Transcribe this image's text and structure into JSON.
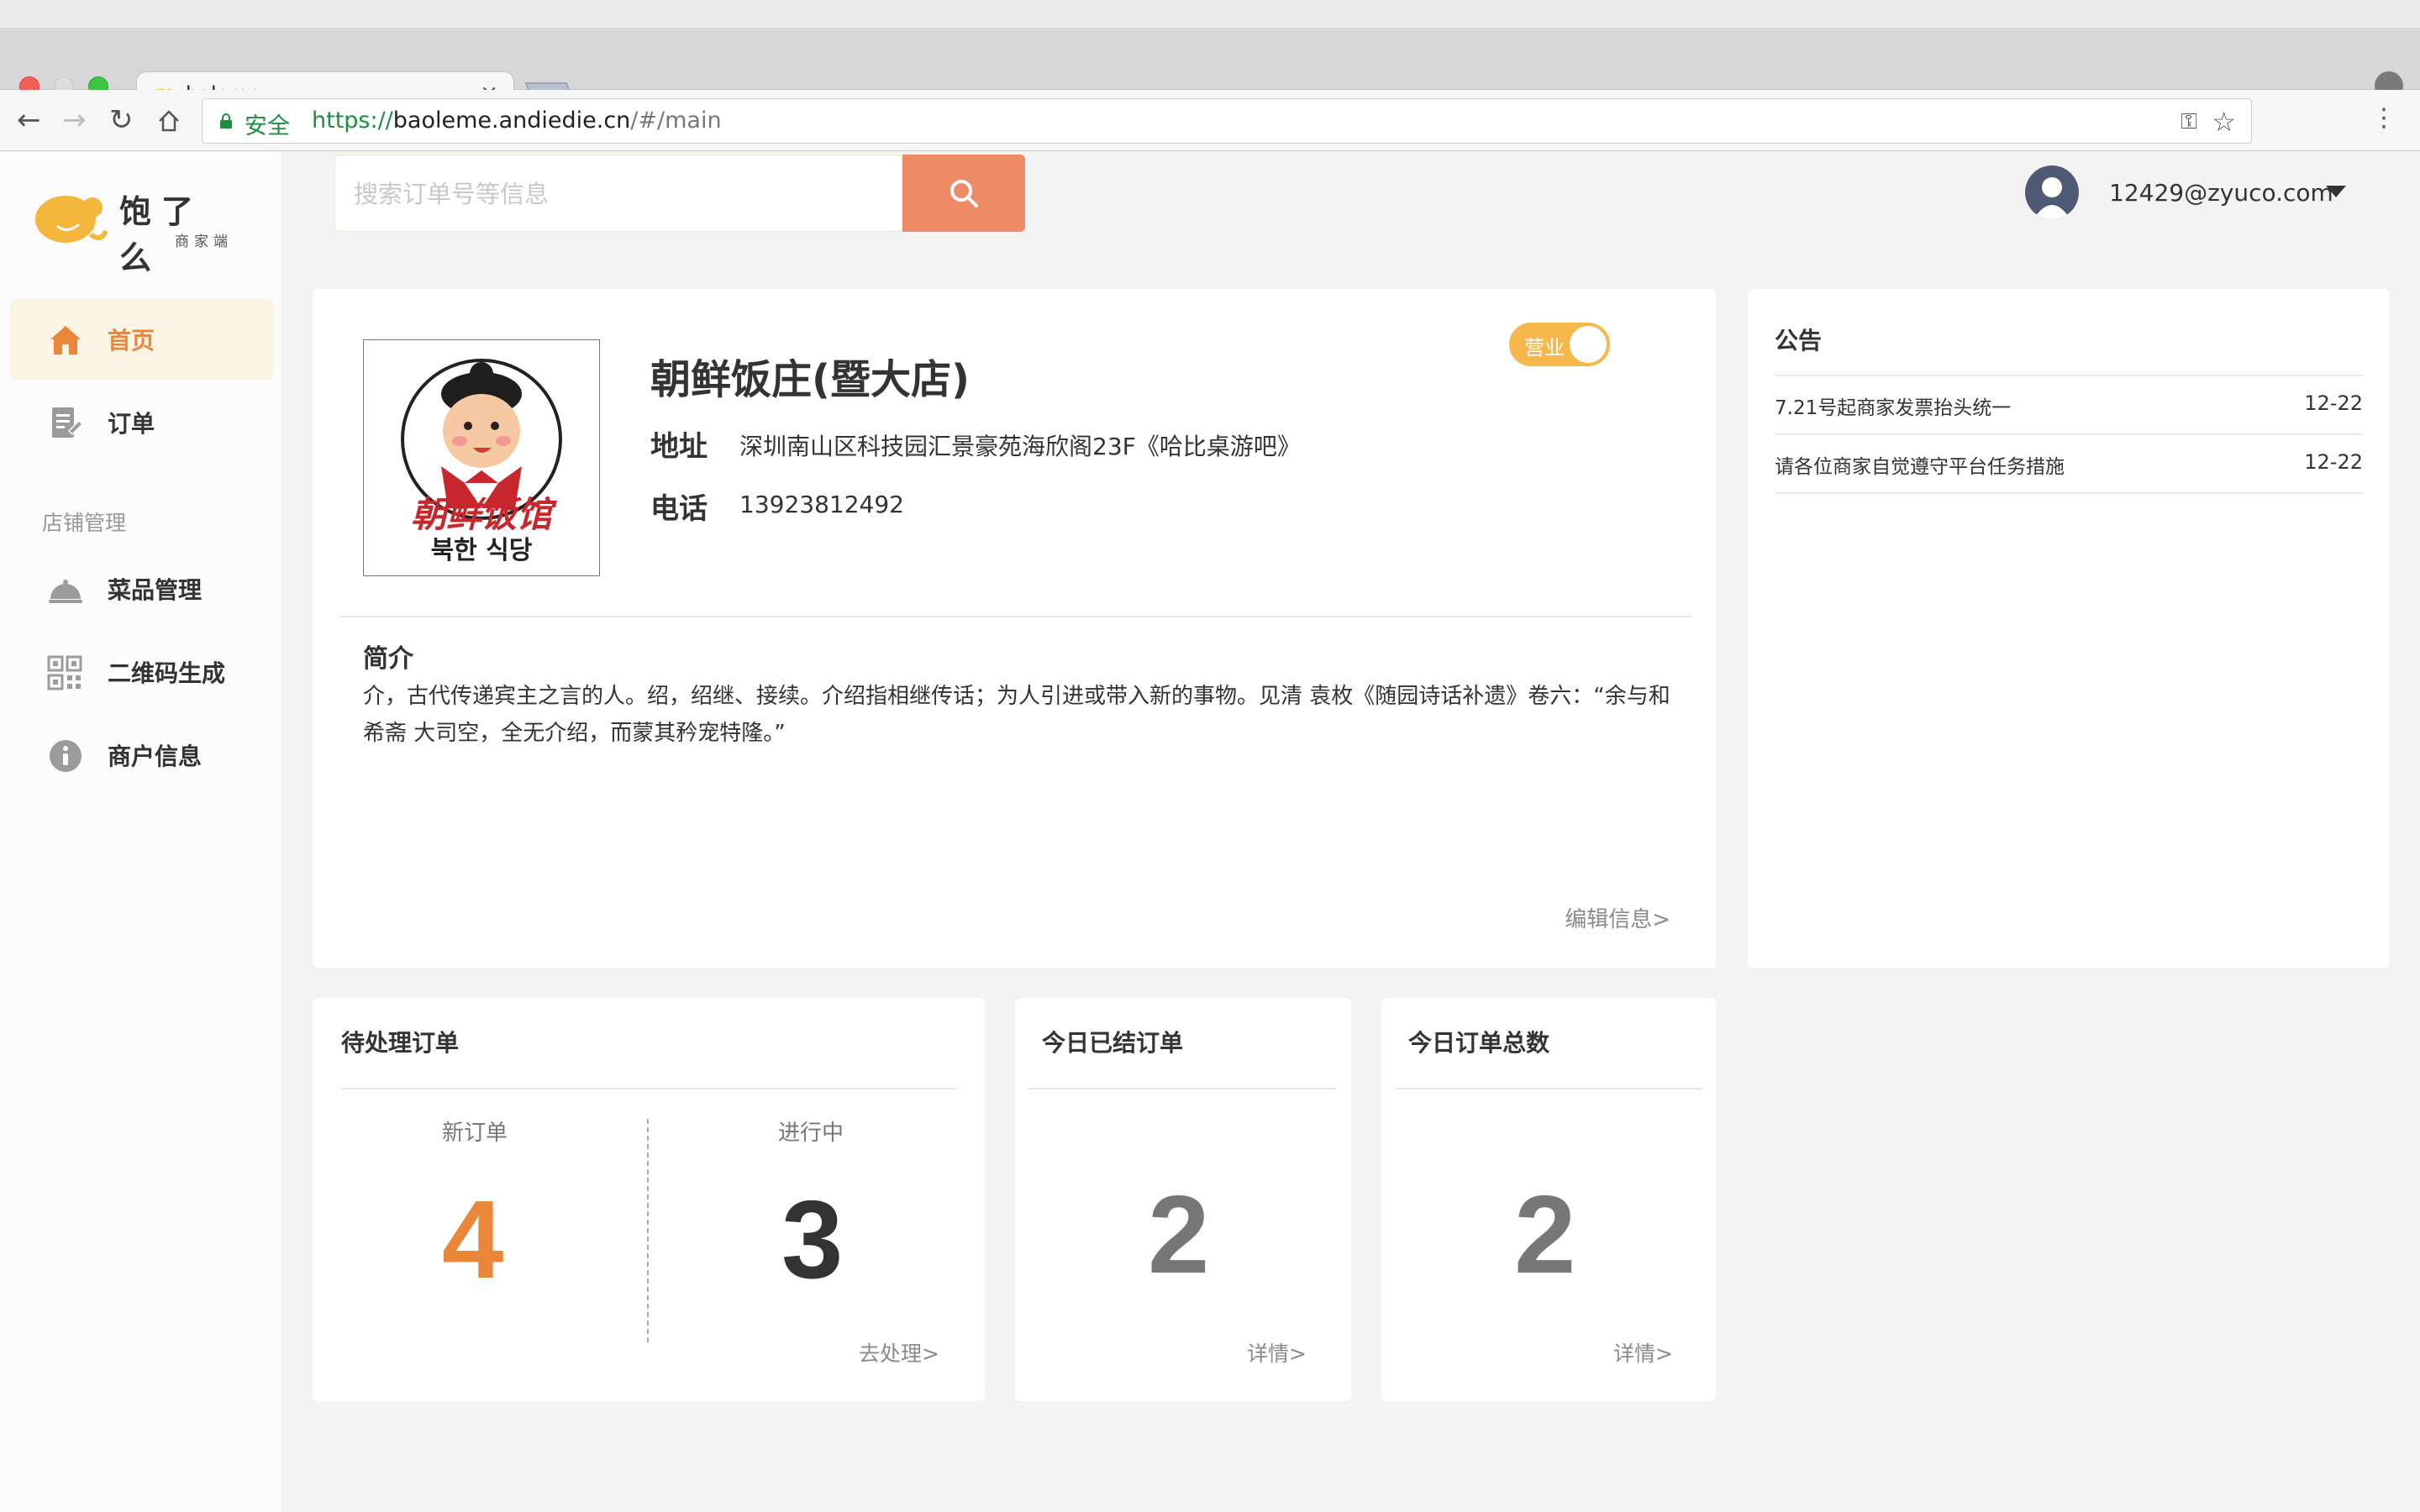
{
  "browser": {
    "tab_title": "baleme",
    "secure_label": "安全",
    "url_scheme": "https://",
    "url_host": "baoleme.andiedie.cn",
    "url_path": "/#/main"
  },
  "brand": {
    "name": "饱了么",
    "subtitle": "商家端",
    "accent": "#e8873a",
    "logo_color": "#f5b73b"
  },
  "search": {
    "placeholder": "搜索订单号等信息",
    "button_color": "#ed8b67"
  },
  "user": {
    "email": "12429@zyuco.com"
  },
  "sidebar": {
    "items": [
      {
        "label": "首页",
        "icon": "home-icon",
        "active": true
      },
      {
        "label": "订单",
        "icon": "order-icon",
        "active": false
      }
    ],
    "section_label": "店铺管理",
    "shop_items": [
      {
        "label": "菜品管理",
        "icon": "dish-icon"
      },
      {
        "label": "二维码生成",
        "icon": "qrcode-icon"
      },
      {
        "label": "商户信息",
        "icon": "info-icon"
      }
    ]
  },
  "shop": {
    "name": "朝鲜饭庄(暨大店)",
    "status_label": "营业",
    "status_on": true,
    "address_label": "地址",
    "address": "深圳南山区科技园汇景豪苑海欣阁23F《哈比桌游吧》",
    "phone_label": "电话",
    "phone": "13923812492",
    "intro_title": "简介",
    "intro_text": "介，古代传递宾主之言的人。绍，绍继、接续。介绍指相继传话；为人引进或带入新的事物。见清 袁枚《随园诗话补遗》卷六：“余与和希斋 大司空，全无介绍，而蒙其矜宠特隆。”",
    "edit_link": "编辑信息>",
    "logo_text_top": "朝鲜饭馆",
    "logo_text_bottom": "북한 식당"
  },
  "notice": {
    "title": "公告",
    "items": [
      {
        "text": "7.21号起商家发票抬头统一",
        "date": "12-22"
      },
      {
        "text": "请各位商家自觉遵守平台任务措施",
        "date": "12-22"
      }
    ]
  },
  "stats": {
    "pending": {
      "title": "待处理订单",
      "new_label": "新订单",
      "new_count": "4",
      "progress_label": "进行中",
      "progress_count": "3",
      "link": "去处理>"
    },
    "finished_today": {
      "title": "今日已结订单",
      "count": "2",
      "link": "详情>"
    },
    "total_today": {
      "title": "今日订单总数",
      "count": "2",
      "link": "详情>"
    }
  }
}
